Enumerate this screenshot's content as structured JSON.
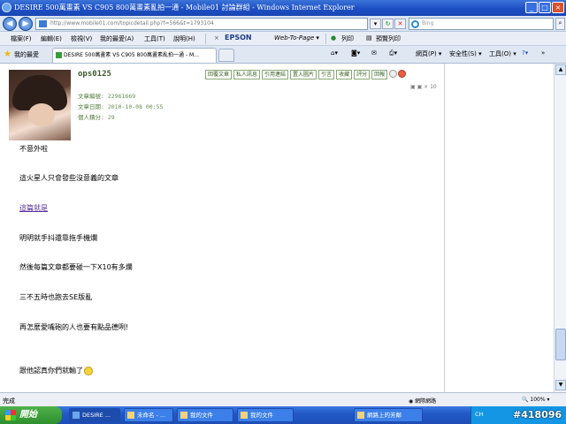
{
  "window": {
    "title": "DESIRE 500萬畫素 VS C905 800萬畫素亂拍一通 - Mobile01 討論群組 - Windows Internet Explorer"
  },
  "address_bar": {
    "url": "http://www.mobile01.com/topicdetail.php?f=566&t=1793104",
    "search_placeholder": "Bing"
  },
  "menu_bar": {
    "items": [
      "檔案(F)",
      "編輯(E)",
      "檢視(V)",
      "我的最愛(A)",
      "工具(T)",
      "說明(H)"
    ],
    "epson": "EPSON",
    "web_to_page": "Web-To-Page ▾",
    "print": "列印",
    "preview": "預覽列印"
  },
  "tabs_bar": {
    "favorites": "我的最愛",
    "tab_title": "DESIRE 500萬畫素 VS C905 800萬畫素亂拍一通 - M...",
    "tools": [
      "網頁(P) ▾",
      "安全性(S) ▾",
      "工具(O) ▾"
    ]
  },
  "post": {
    "username": "ops0125",
    "article_count_label": "文章編號:",
    "article_count": "22961669",
    "date_label": "文章日期:",
    "date": "2010-10-08 00:55",
    "points_label": "個人積分:",
    "points": "29",
    "actions": [
      "回覆文章",
      "私人訊息",
      "引用連結",
      "置入圖片",
      "引言",
      "收藏",
      "評分",
      "回報"
    ],
    "size_control": "▣ ▣ × 10",
    "lines": [
      "不意外啦",
      "這火星人只會發些沒意義的文章",
      "這篇就是",
      "明明就手抖還靠拖手機爛",
      "然後每篇文章都要碰一下X10有多爛",
      "三不五時也跑去SE版亂",
      "再怎麼愛嘴砲的人也要有點品德咧!",
      "跟他認真你們就輸了"
    ]
  },
  "status_bar": {
    "left": "完成",
    "zone": "網際網路",
    "zoom": "100%"
  },
  "taskbar": {
    "start": "開始",
    "tasks": [
      "DESIRE ...",
      "未命名 - ...",
      "我的文件",
      "我的文件",
      "網路上的芳鄰"
    ],
    "lang": "CH",
    "watermark": "#418096"
  }
}
